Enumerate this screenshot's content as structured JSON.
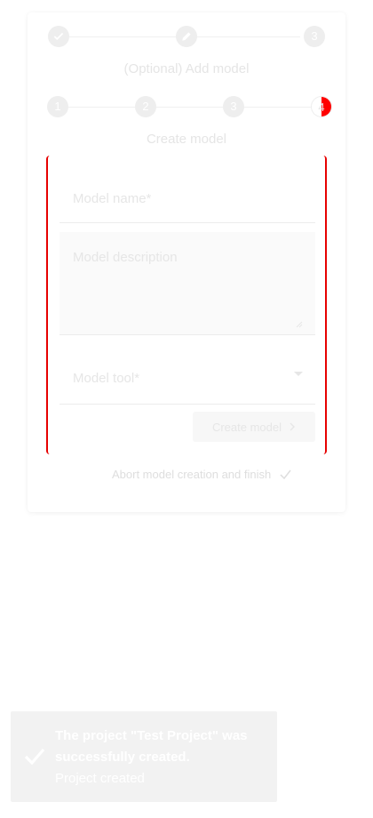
{
  "stepper_top": {
    "steps": [
      {
        "icon": "check-icon"
      },
      {
        "icon": "pencil-icon"
      },
      {
        "number": "3"
      }
    ],
    "title": "(Optional) Add model"
  },
  "stepper_inner": {
    "steps": [
      {
        "number": "1"
      },
      {
        "number": "2"
      },
      {
        "number": "3"
      },
      {
        "number": "4"
      }
    ],
    "title": "Create model"
  },
  "form": {
    "model_name_label": "Model name*",
    "model_description_label": "Model description",
    "model_tool_label": "Model tool*",
    "create_button_label": "Create model"
  },
  "abort_label": "Abort model creation and finish",
  "toast": {
    "title": "The project \"Test Project\" was successfully created.",
    "subtitle": "Project created"
  },
  "colors": {
    "accent": "#e60000",
    "disabled_text": "#e6e6e6"
  }
}
